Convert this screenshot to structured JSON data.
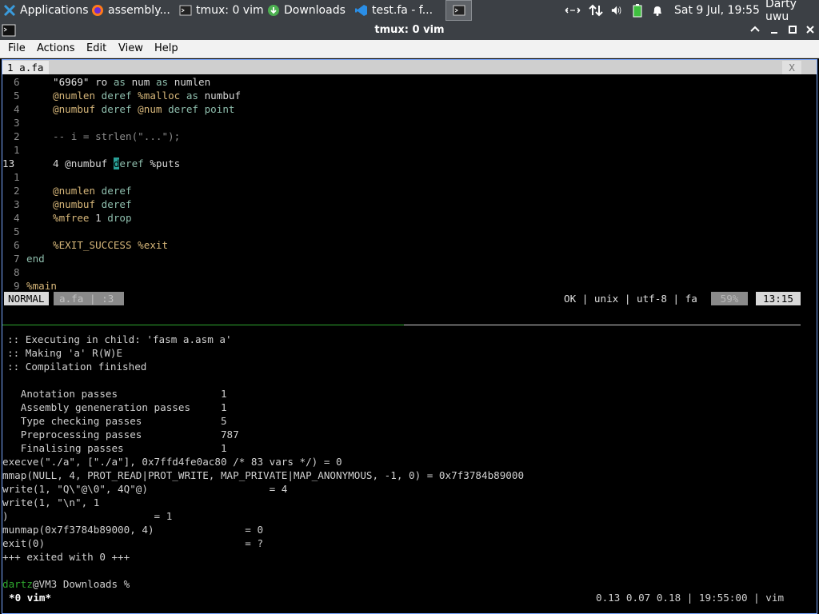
{
  "taskbar": {
    "apps_label": "Applications",
    "tasks": [
      {
        "label": "assembly..."
      },
      {
        "label": "tmux: 0 vim"
      },
      {
        "label": "Downloads"
      },
      {
        "label": "test.fa - f..."
      }
    ],
    "clock": "Sat  9 Jul, 19:55",
    "user": "Darty uwu"
  },
  "window": {
    "title": "tmux: 0 vim",
    "menu": [
      "File",
      "Actions",
      "Edit",
      "View",
      "Help"
    ]
  },
  "vim": {
    "tab_label": "1 a.fa",
    "tab_close": "X",
    "lines": [
      {
        "num": "6",
        "code": "\"6969\" ro as num as numlen"
      },
      {
        "num": "5",
        "code": "@numlen deref %malloc as numbuf"
      },
      {
        "num": "4",
        "code": "@numbuf deref @num deref point"
      },
      {
        "num": "3",
        "code": ""
      },
      {
        "num": "2",
        "code": "-- i = strlen(\"...\");"
      },
      {
        "num": "1",
        "code": ""
      },
      {
        "num": "13",
        "code": "4 @numbuf deref %puts"
      },
      {
        "num": "1",
        "code": ""
      },
      {
        "num": "2",
        "code": "@numlen deref"
      },
      {
        "num": "3",
        "code": "@numbuf deref"
      },
      {
        "num": "4",
        "code": "%mfree 1 drop"
      },
      {
        "num": "5",
        "code": ""
      },
      {
        "num": "6",
        "code": "%EXIT_SUCCESS %exit"
      },
      {
        "num": "7",
        "code": "end"
      },
      {
        "num": "8",
        "code": ""
      },
      {
        "num": "9",
        "code": "%main"
      }
    ],
    "status": {
      "mode": "NORMAL",
      "file": "a.fa",
      "sep": "|",
      "col": ":3",
      "info": "OK | unix | utf-8 | fa",
      "percent": "59%",
      "pos": "13:15"
    }
  },
  "output": {
    "lines": [
      ":: Executing in child: 'fasm a.asm a'",
      ":: Making 'a' R(W)E",
      ":: Compilation finished",
      "",
      "   Anotation passes                 1",
      "   Assembly geneneration passes     1",
      "   Type checking passes             5",
      "   Preprocessing passes             787",
      "   Finalising passes                1",
      "execve(\"./a\", [\"./a\"], 0x7ffd4fe0ac80 /* 83 vars */) = 0",
      "mmap(NULL, 4, PROT_READ|PROT_WRITE, MAP_PRIVATE|MAP_ANONYMOUS, -1, 0) = 0x7f3784b89000",
      "write(1, \"Q\\\"@\\0\", 4Q\"@)                    = 4",
      "write(1, \"\\n\", 1",
      ")                        = 1",
      "munmap(0x7f3784b89000, 4)               = 0",
      "exit(0)                                 = ?",
      "+++ exited with 0 +++"
    ],
    "prompt_user": "dartz",
    "prompt_rest": "@VM3 Downloads %"
  },
  "tmux": {
    "window": "*0 vim*",
    "right": "0.13 0.07 0.18 | 19:55:00 | vim"
  },
  "colors": {
    "panel": "#3c4045",
    "accent_blue": "#7aa8ff",
    "statusline": "#d8d8d8",
    "prompt_green": "#2ea82e"
  }
}
